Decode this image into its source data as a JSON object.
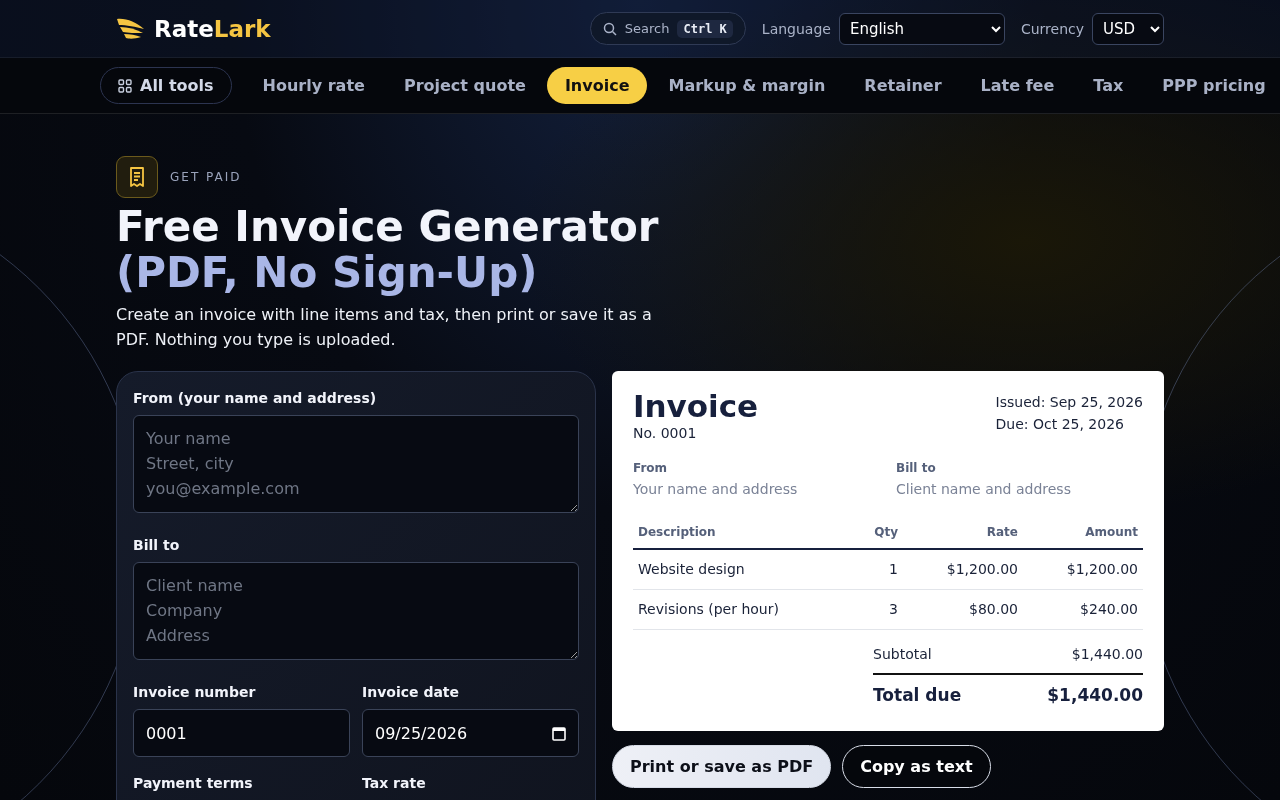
{
  "header": {
    "logo": {
      "first": "Rate",
      "second": "Lark"
    },
    "search": {
      "label": "Search",
      "shortcut": "Ctrl K"
    },
    "language": {
      "label": "Language",
      "value": "English"
    },
    "currency": {
      "label": "Currency",
      "value": "USD"
    }
  },
  "nav": [
    {
      "label": "All tools",
      "kind": "all",
      "selected": false
    },
    {
      "label": "Hourly rate",
      "kind": "link",
      "selected": false
    },
    {
      "label": "Project quote",
      "kind": "link",
      "selected": false
    },
    {
      "label": "Invoice",
      "kind": "link",
      "selected": true
    },
    {
      "label": "Markup & margin",
      "kind": "link",
      "selected": false
    },
    {
      "label": "Retainer",
      "kind": "link",
      "selected": false
    },
    {
      "label": "Late fee",
      "kind": "link",
      "selected": false
    },
    {
      "label": "Tax",
      "kind": "link",
      "selected": false
    },
    {
      "label": "PPP pricing",
      "kind": "link",
      "selected": false
    }
  ],
  "hero": {
    "eyebrow": "GET PAID",
    "title": "Free Invoice Generator",
    "subtitle": "(PDF, No Sign-Up)",
    "description": "Create an invoice with line items and tax, then print or save it as a PDF. Nothing you type is uploaded."
  },
  "form": {
    "from": {
      "label": "From (your name and address)",
      "placeholder": "Your name\nStreet, city\nyou@example.com"
    },
    "bill_to": {
      "label": "Bill to",
      "placeholder": "Client name\nCompany\nAddress"
    },
    "invoice_number": {
      "label": "Invoice number",
      "value": "0001"
    },
    "invoice_date": {
      "label": "Invoice date",
      "value": "09/25/2026"
    },
    "payment_terms": {
      "label": "Payment terms"
    },
    "tax_rate": {
      "label": "Tax rate"
    }
  },
  "preview": {
    "title": "Invoice",
    "number": "No. 0001",
    "issued": "Issued: Sep 25, 2026",
    "due": "Due: Oct 25, 2026",
    "from": {
      "label": "From",
      "value": "Your name and address"
    },
    "bill_to": {
      "label": "Bill to",
      "value": "Client name and address"
    },
    "columns": [
      "Description",
      "Qty",
      "Rate",
      "Amount"
    ],
    "rows": [
      [
        "Website design",
        "1",
        "$1,200.00",
        "$1,200.00"
      ],
      [
        "Revisions (per hour)",
        "3",
        "$80.00",
        "$240.00"
      ]
    ],
    "subtotal": {
      "label": "Subtotal",
      "value": "$1,440.00"
    },
    "total": {
      "label": "Total due",
      "value": "$1,440.00"
    }
  },
  "actions": [
    {
      "label": "Print or save as PDF",
      "kind": "primary"
    },
    {
      "label": "Copy as text",
      "kind": "secondary"
    }
  ]
}
